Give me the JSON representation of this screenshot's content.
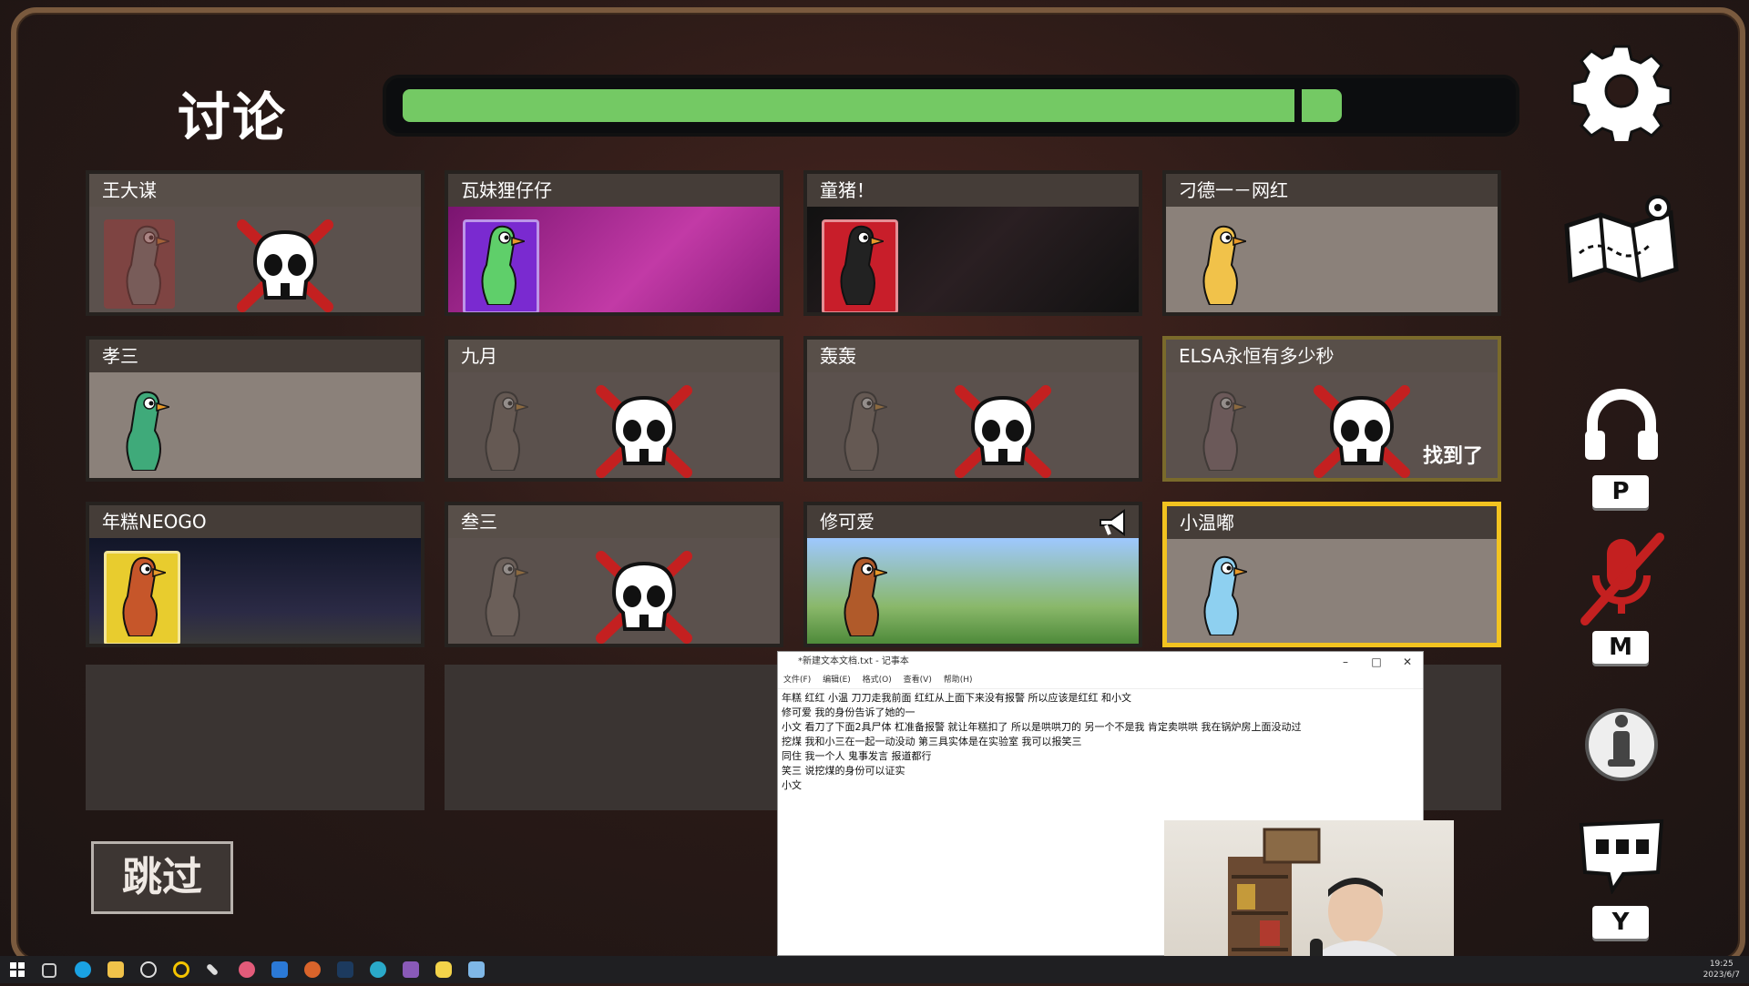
{
  "header": {
    "title": "讨论",
    "progress": 0.862
  },
  "players": [
    {
      "name": "王大谋",
      "status": "dead",
      "found": ""
    },
    {
      "name": "瓦妹狸仔仔",
      "status": "alive",
      "found": ""
    },
    {
      "name": "童猪！",
      "status": "alive",
      "found": ""
    },
    {
      "name": "刁德一－网红",
      "status": "alive",
      "found": ""
    },
    {
      "name": "孝三",
      "status": "alive",
      "found": ""
    },
    {
      "name": "九月",
      "status": "dead",
      "found": ""
    },
    {
      "name": "轰轰",
      "status": "dead",
      "found": ""
    },
    {
      "name": "ELSA永恒有多少秒",
      "status": "dead",
      "found": "找到了"
    },
    {
      "name": "年糕NEOGO",
      "status": "alive",
      "found": ""
    },
    {
      "name": "叁三",
      "status": "dead",
      "found": ""
    },
    {
      "name": "修可爱",
      "status": "alive",
      "found": "",
      "speaking": true
    },
    {
      "name": "小温嘟",
      "status": "alive",
      "found": "",
      "selected": true
    }
  ],
  "skip_label": "跳过",
  "side": {
    "voice_key": "P",
    "mute_key": "M",
    "chat_key": "Y"
  },
  "notepad": {
    "title": "*新建文本文档.txt - 记事本",
    "menu": [
      "文件(F)",
      "编辑(E)",
      "格式(O)",
      "查看(V)",
      "帮助(H)"
    ],
    "lines": [
      "年糕 红红 小温   刀刀走我前面 红红从上面下来没有报警  所以应该是红红 和小文",
      "修可爱 我的身份告诉了她的一",
      "小文 看刀了下面2具尸体 杠准备报警 就让年糕扣了 所以是哄哄刀的 另一个不是我      肯定卖哄哄 我在锅炉房上面没动过",
      "挖煤 我和小三在一起一动没动 第三具实体是在实验室 我可以报笑三",
      "同住 我一个人 鬼事发言 报道都行",
      "笑三 说挖煤的身份可以证实",
      "小文"
    ]
  },
  "taskbar": {
    "time": "19:25",
    "date": "2023/6/7"
  },
  "colors": {
    "progress": "#74c964",
    "selected": "#f2c320",
    "red_x": "#c42020"
  }
}
